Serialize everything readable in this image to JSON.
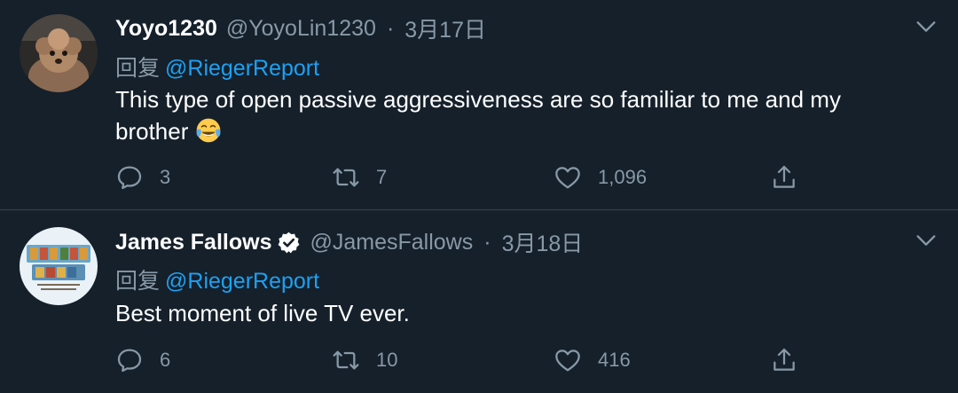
{
  "tweets": [
    {
      "display_name": "Yoyo1230",
      "handle": "@YoyoLin1230",
      "separator": "·",
      "date": "3月17日",
      "reply_prefix": "回复",
      "reply_mention": "@RiegerReport",
      "text": "This type of open passive aggressiveness are so familiar to me and my brother",
      "emoji": "face-with-tears-of-joy",
      "verified": false,
      "reply_count": "3",
      "retweet_count": "7",
      "like_count": "1,096"
    },
    {
      "display_name": "James Fallows",
      "handle": "@JamesFallows",
      "separator": "·",
      "date": "3月18日",
      "reply_prefix": "回复",
      "reply_mention": "@RiegerReport",
      "text": "Best moment of live TV ever.",
      "verified": true,
      "reply_count": "6",
      "retweet_count": "10",
      "like_count": "416"
    }
  ],
  "colors": {
    "background": "#15202b",
    "primary_text": "#ffffff",
    "secondary_text": "#8899a6",
    "link": "#1da1f2",
    "divider": "#38444d"
  }
}
